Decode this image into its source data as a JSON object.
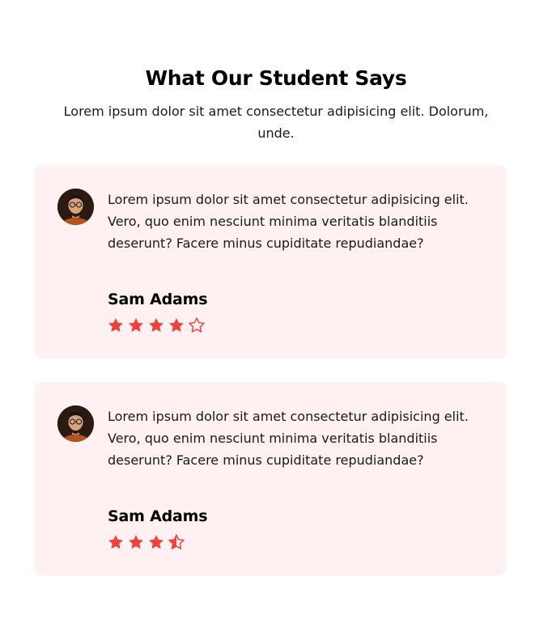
{
  "section": {
    "title": "What Our Student Says",
    "subtitle": "Lorem ipsum dolor sit amet consectetur adipisicing elit. Dolorum, unde."
  },
  "colors": {
    "card_background": "#fff1f1",
    "star": "#f0413e",
    "text": "#1a1a1a"
  },
  "testimonials": [
    {
      "quote": "Lorem ipsum dolor sit amet consectetur adipisicing elit. Vero, quo enim nesciunt minima veritatis blanditiis deserunt? Facere minus cupiditate repudiandae?",
      "name": "Sam Adams",
      "avatar_icon": "user-avatar-photo",
      "rating": 4,
      "rating_max": 5
    },
    {
      "quote": "Lorem ipsum dolor sit amet consectetur adipisicing elit. Vero, quo enim nesciunt minima veritatis blanditiis deserunt? Facere minus cupiditate repudiandae?",
      "name": "Sam Adams",
      "avatar_icon": "user-avatar-photo",
      "rating": 3.5,
      "rating_max": 4
    }
  ]
}
